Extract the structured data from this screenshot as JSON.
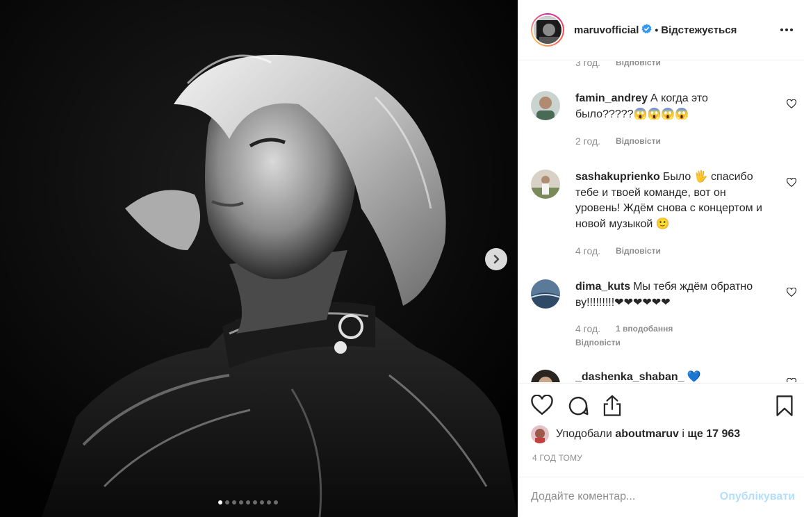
{
  "post": {
    "photo": {
      "alt_icon": "photo-icon"
    },
    "carousel": {
      "slide_count": 9,
      "active_index": 0
    },
    "header": {
      "username": "maruvofficial",
      "separator": "•",
      "follow_status": "Відстежується"
    },
    "comments": [
      {
        "time": "3 год.",
        "reply": "Відповісти"
      },
      {
        "username": "famin_andrey",
        "text": "А когда это было?????😱😱😱😱",
        "time": "2 год.",
        "reply": "Відповісти"
      },
      {
        "username": "sashakuprienko",
        "text": "Было 🖐 спасибо тебе и твоей команде, вот он уровень! Ждём снова с концертом и новой музыкой 🙂",
        "time": "4 год.",
        "reply": "Відповісти"
      },
      {
        "username": "dima_kuts",
        "text": "Мы тебя ждём обратно ву!!!!!!!!!❤❤❤❤❤❤",
        "time": "4 год.",
        "likes": "1 вподобання",
        "reply": "Відповісти"
      },
      {
        "username": "_dashenka_shaban_",
        "text": "💙"
      }
    ],
    "likes": {
      "prefix": "Уподобали",
      "user": "aboutmaruv",
      "suffix_and": "і",
      "suffix_more": "ще 17 963"
    },
    "timestamp": "4 ГОД ТОМУ",
    "add_comment": {
      "placeholder": "Додайте коментар...",
      "publish_label": "Опублікувати"
    },
    "colors": {
      "text": "#262626",
      "muted": "#8e8e8e",
      "link_disabled": "#b2dffc",
      "verified": "#3897f0",
      "border": "#efefef"
    }
  }
}
